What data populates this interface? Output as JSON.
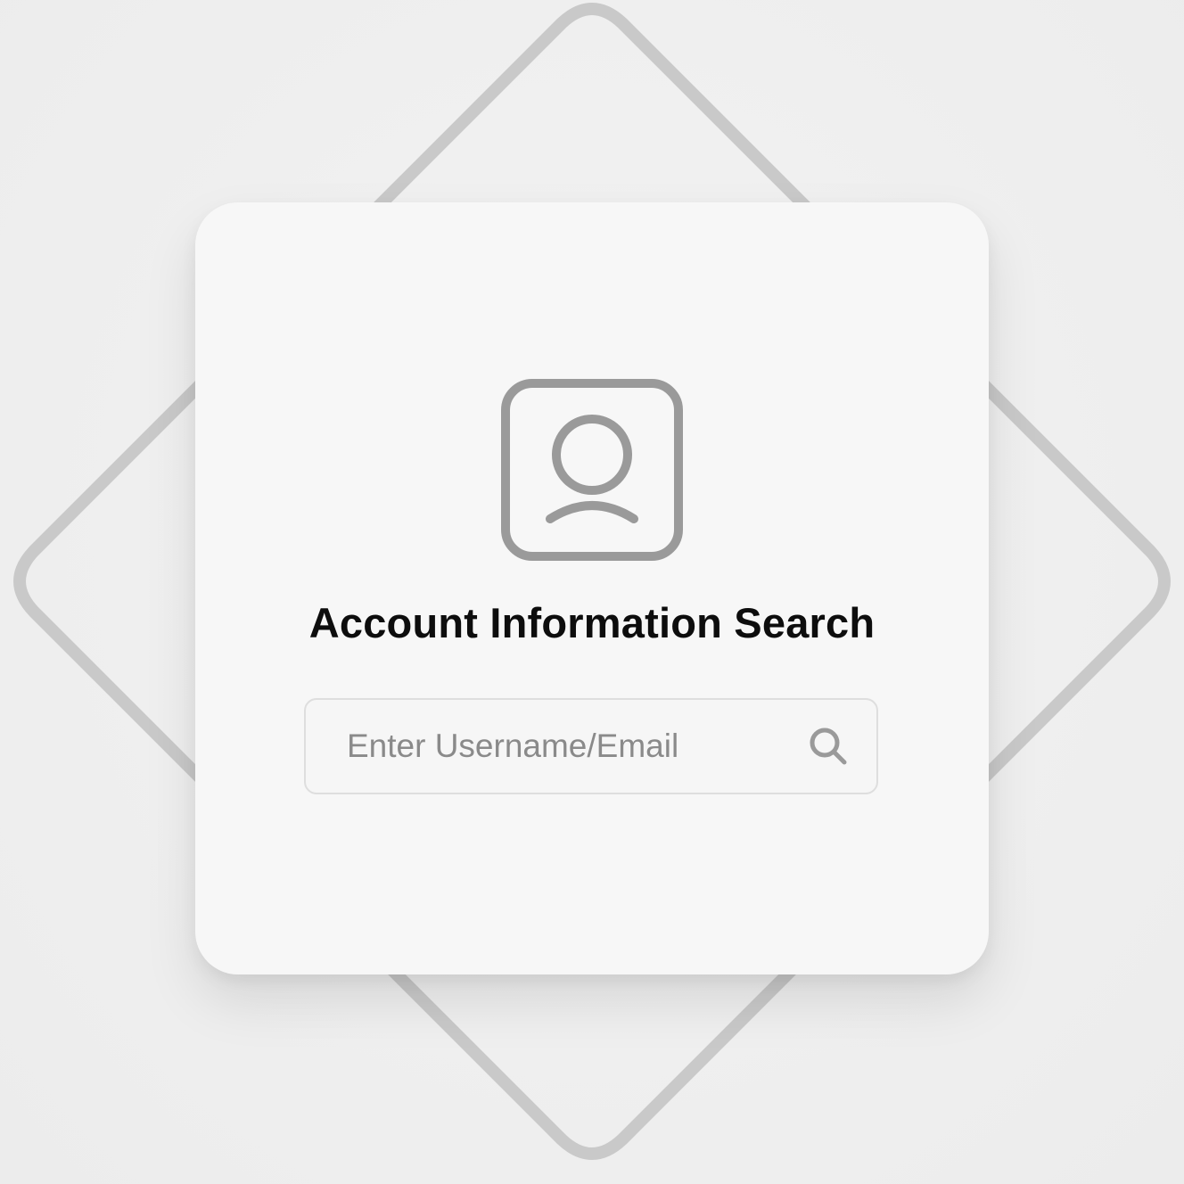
{
  "dialog": {
    "title": "Account Information Search"
  },
  "search": {
    "placeholder": "Enter Username/Email",
    "value": ""
  },
  "icons": {
    "avatar": "user-profile-icon",
    "search": "magnifier-icon"
  },
  "colors": {
    "background": "#efefef",
    "card": "#f7f7f7",
    "icon_gray": "#9a9a9a",
    "diamond_stroke": "#c8c8c8",
    "title": "#0d0d0d"
  }
}
